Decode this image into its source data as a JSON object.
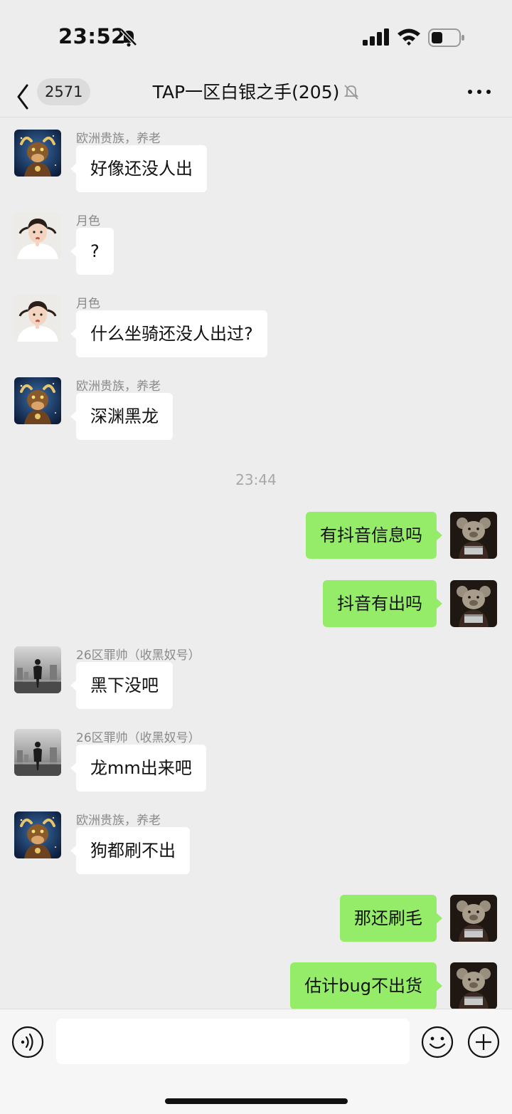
{
  "status_bar": {
    "time": "23:52",
    "icons": [
      "bell-slash-icon",
      "cellular-signal-icon",
      "wifi-icon",
      "battery-icon"
    ]
  },
  "header": {
    "back_icon": "chevron-left-icon",
    "unread_count": "2571",
    "title": "TAP一区白银之手(205)",
    "mute_icon": "bell-slash-icon",
    "more_icon": "more-dots-icon"
  },
  "messages": [
    {
      "direction": "in",
      "sender": "欧洲贵族，养老",
      "text": "好像还没人出"
    },
    {
      "direction": "in",
      "sender": "月色",
      "text": "?"
    },
    {
      "direction": "in",
      "sender": "月色",
      "text": "什么坐骑还没人出过?"
    },
    {
      "direction": "in",
      "sender": "欧洲贵族，养老",
      "text": "深渊黑龙"
    },
    {
      "direction": "out",
      "text": "有抖音信息吗"
    },
    {
      "direction": "out",
      "text": "抖音有出吗"
    },
    {
      "direction": "in",
      "sender": "26区罪帅（收黑奴号）",
      "text": "黑下没吧"
    },
    {
      "direction": "in",
      "sender": "26区罪帅（收黑奴号）",
      "text": "龙mm出来吧"
    },
    {
      "direction": "in",
      "sender": "欧洲贵族，养老",
      "text": "狗都刷不出"
    },
    {
      "direction": "out",
      "text": "那还刷毛"
    },
    {
      "direction": "out",
      "text": "估计bug不出货"
    }
  ],
  "time_divider": "23:44",
  "input_bar": {
    "value": "",
    "icons": [
      "voice-icon",
      "emoji-icon",
      "plus-icon"
    ]
  },
  "colors": {
    "background": "#EDEDED",
    "bubble_in": "#FFFFFF",
    "bubble_out": "#95EC69",
    "sender_text": "#8A8A8A"
  }
}
